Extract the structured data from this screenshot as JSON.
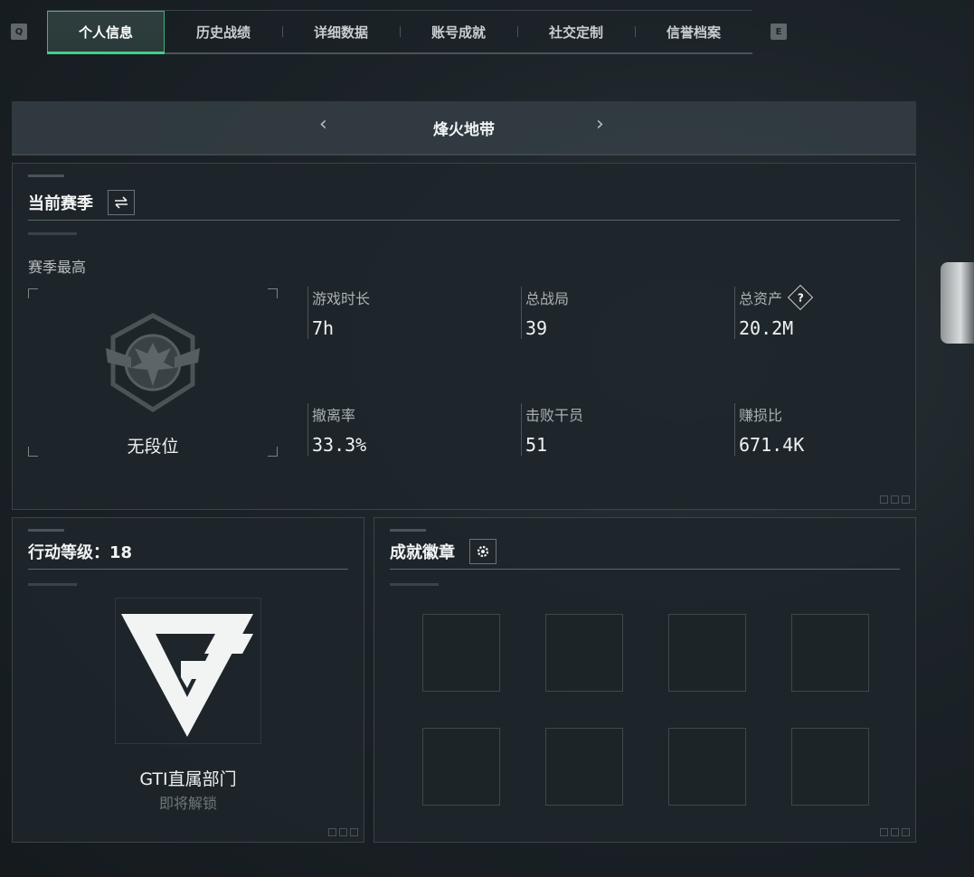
{
  "tabs": {
    "key_left": "Q",
    "key_right": "E",
    "items": [
      "个人信息",
      "历史战绩",
      "详细数据",
      "账号成就",
      "社交定制",
      "信誉档案"
    ]
  },
  "mode": {
    "title": "烽火地带",
    "prev": "‹",
    "next": "›"
  },
  "season": {
    "title": "当前赛季",
    "swap_icon": "swap-arrows-icon",
    "sub_label": "赛季最高",
    "rank_name": "无段位",
    "stats": {
      "play_time": {
        "label": "游戏时长",
        "value": "7h"
      },
      "total_games": {
        "label": "总战局",
        "value": "39"
      },
      "total_assets": {
        "label": "总资产",
        "value": "20.2M"
      },
      "extract_rate": {
        "label": "撤离率",
        "value": "33.3%"
      },
      "kills": {
        "label": "击败干员",
        "value": "51"
      },
      "profit_ratio": {
        "label": "赚损比",
        "value": "671.4K"
      }
    },
    "help_symbol": "?"
  },
  "level": {
    "title": "行动等级：18",
    "department": "GTI直属部门",
    "status": "即将解锁"
  },
  "badges": {
    "title": "成就徽章",
    "settings_icon": "gear-icon",
    "slot_count": 8
  },
  "colors": {
    "accent": "#3fd08a",
    "panel": "#1e262b",
    "text": "#dfe4e6"
  }
}
